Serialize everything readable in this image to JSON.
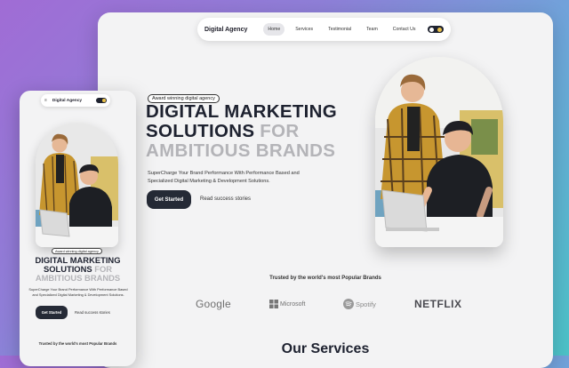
{
  "desktop": {
    "nav": {
      "brand": "Digital Agency",
      "links": [
        "Home",
        "Services",
        "Testimonial",
        "Team",
        "Contact Us"
      ],
      "active": "Home"
    },
    "hero": {
      "badge": "Award winning digital agency",
      "line1": "DIGITAL MARKETING",
      "line2_dark": "SOLUTIONS",
      "line2_grey": "FOR",
      "line3": "AMBITIOUS BRANDS",
      "description": "SuperCharge Your Brand Performance With Performance Based and Specialized Digital Marketing & Development Solutions.",
      "cta_label": "Get Started",
      "secondary_link": "Read success stories"
    },
    "trusted_title": "Trusted by the world's most Popular Brands",
    "brands": [
      "Google",
      "Microsoft",
      "Spotify",
      "NETFLIX"
    ],
    "services_title": "Our Services"
  },
  "mobile": {
    "menu_icon": "≡",
    "brand": "Digital Agency",
    "badge": "Award winning digital agency",
    "line1": "DIGITAL MARKETING",
    "line2_dark": "SOLUTIONS",
    "line2_grey": "FOR",
    "line3": "AMBITIOUS BRANDS",
    "description": "SuperCharge Your Brand Performance With Performance Based and Specialized Digital Marketing & Development Solutions.",
    "cta_label": "Get Started",
    "secondary_link": "Read success stories",
    "trusted_title": "Trusted by the world's most Popular Brands"
  },
  "colors": {
    "accent_dark": "#252a36",
    "heading": "#1e2230",
    "heading_muted": "#b4b4b8",
    "toggle_sun": "#e9c14a"
  },
  "icons": {
    "theme_toggle": "theme-toggle-icon",
    "microsoft": "microsoft-logo-icon",
    "spotify": "spotify-logo-icon",
    "menu": "menu-icon"
  }
}
